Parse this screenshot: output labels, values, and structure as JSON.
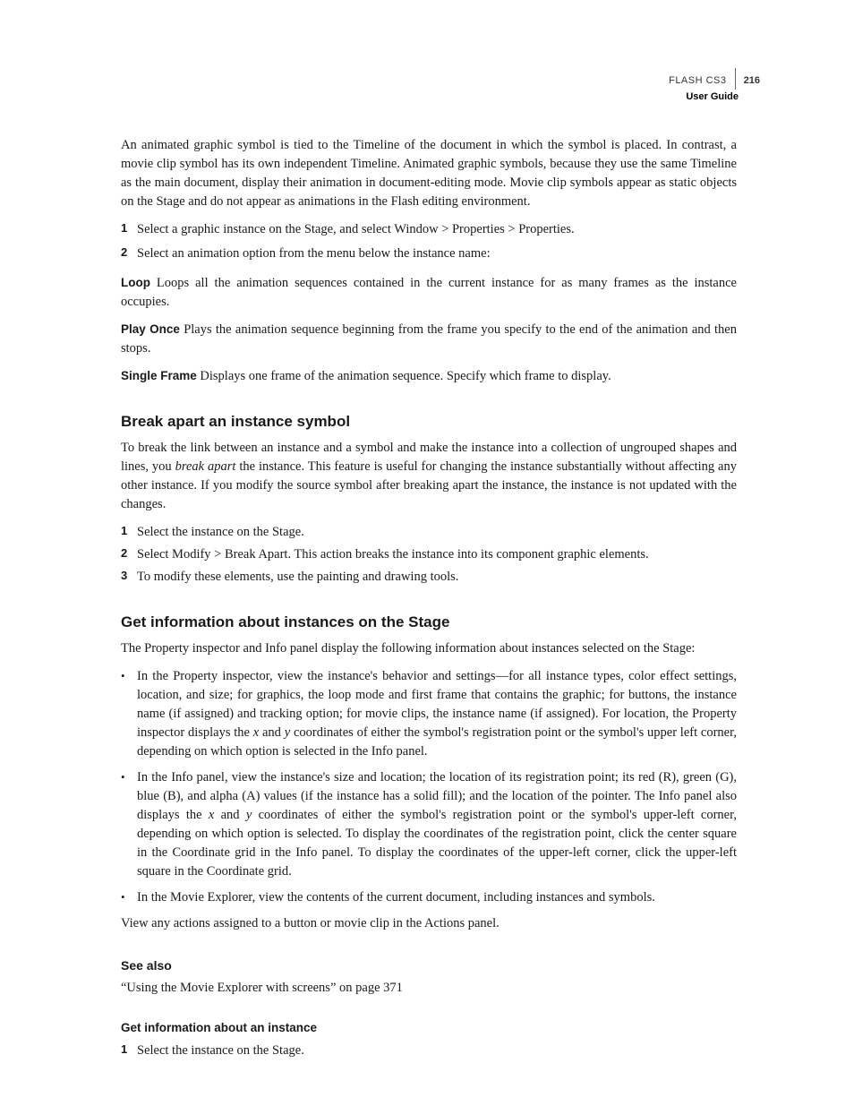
{
  "header": {
    "product": "FLASH CS3",
    "pagenum": "216",
    "guide": "User Guide"
  },
  "intro": "An animated graphic symbol is tied to the Timeline of the document in which the symbol is placed. In contrast, a movie clip symbol has its own independent Timeline. Animated graphic symbols, because they use the same Timeline as the main document, display their animation in document-editing mode. Movie clip symbols appear as static objects on the Stage and do not appear as animations in the Flash editing environment.",
  "steps1": [
    "Select a graphic instance on the Stage, and select Window > Properties > Properties.",
    "Select an animation option from the menu below the instance name:"
  ],
  "defs": [
    {
      "term": "Loop",
      "text": "  Loops all the animation sequences contained in the current instance for as many frames as the instance occupies."
    },
    {
      "term": "Play Once",
      "text": "  Plays the animation sequence beginning from the frame you specify to the end of the animation and then stops."
    },
    {
      "term": "Single Frame",
      "text": "  Displays one frame of the animation sequence. Specify which frame to display."
    }
  ],
  "section2": {
    "heading": "Break apart an instance symbol",
    "para_pre": "To break the link between an instance and a symbol and make the instance into a collection of ungrouped shapes and lines, you ",
    "para_em": "break apart",
    "para_post": " the instance. This feature is useful for changing the instance substantially without affecting any other instance. If you modify the source symbol after breaking apart the instance, the instance is not updated with the changes.",
    "steps": [
      "Select the instance on the Stage.",
      "Select Modify > Break Apart. This action breaks the instance into its component graphic elements.",
      "To modify these elements, use the painting and drawing tools."
    ]
  },
  "section3": {
    "heading": "Get information about instances on the Stage",
    "para": "The Property inspector and Info panel display the following information about instances selected on the Stage:",
    "bullet1_pre": "In the Property inspector, view the instance's behavior and settings—for all instance types, color effect settings, location, and size; for graphics, the loop mode and first frame that contains the graphic; for buttons, the instance name (if assigned) and tracking option; for movie clips, the instance name (if assigned). For location, the Property inspector displays the ",
    "bullet1_x": "x",
    "bullet1_mid": " and ",
    "bullet1_y": "y",
    "bullet1_post": " coordinates of either the symbol's registration point or the symbol's upper left corner, depending on which option is selected in the Info panel.",
    "bullet2_pre": "In the Info panel, view the instance's size and location; the location of its registration point; its red (R), green (G), blue (B), and alpha (A) values (if the instance has a solid fill); and the location of the pointer. The Info panel also displays the ",
    "bullet2_x": "x",
    "bullet2_mid": " and ",
    "bullet2_y": "y",
    "bullet2_post": " coordinates of either the symbol's registration point or the symbol's upper-left corner, depending on which option is selected. To display the coordinates of the registration point, click the center square in the Coordinate grid in the Info panel. To display the coordinates of the upper-left corner, click the upper-left square in the Coordinate grid.",
    "bullet3": "In the Movie Explorer, view the contents of the current document, including instances and symbols.",
    "closing": "View any actions assigned to a button or movie clip in the Actions panel."
  },
  "seealso": {
    "heading": "See also",
    "text": "“Using the Movie Explorer with screens” on page 371"
  },
  "section4": {
    "heading": "Get information about an instance",
    "steps": [
      "Select the instance on the Stage."
    ]
  }
}
